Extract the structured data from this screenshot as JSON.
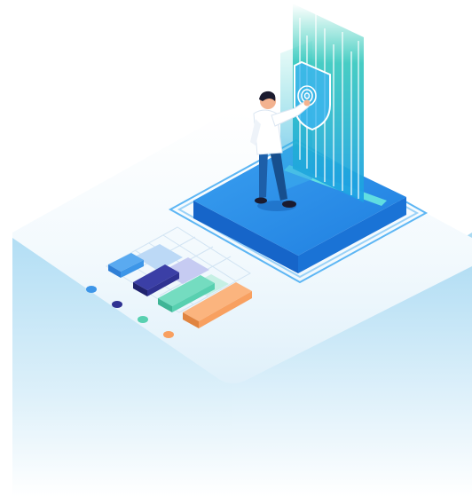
{
  "illustration": {
    "colors": {
      "platform_top": "#2f8fe8",
      "platform_side": "#1665c9",
      "slab_gradient_top": "#f7fbfe",
      "slab_gradient_bottom": "#bfe3f5",
      "panel_teal": "#24c3b3",
      "panel_blue": "#1da1e8",
      "person_shirt": "#ffffff",
      "person_pants": "#1d5fa9",
      "person_hair": "#1b1b2f"
    },
    "mini_chart": {
      "bars": [
        {
          "color": "#3d96e8",
          "shadow": "#bcd9f6"
        },
        {
          "color": "#2f3292",
          "shadow": "#c6cbf2"
        },
        {
          "color": "#58d0b0",
          "shadow": "#c6f0e4"
        },
        {
          "color": "#f8a060",
          "shadow": "#fddcc2"
        }
      ],
      "dots": [
        "#3d96e8",
        "#2f3292",
        "#58d0b0",
        "#f8a060"
      ]
    }
  }
}
